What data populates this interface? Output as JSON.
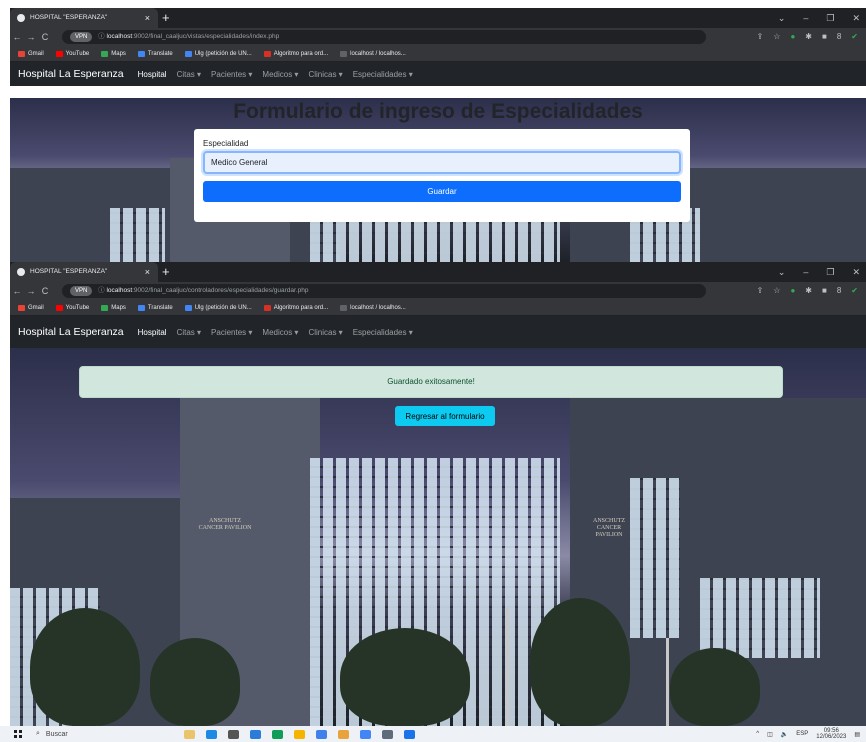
{
  "shot1": {
    "tab_title": "HOSPITAL \"ESPERANZA\"",
    "url_host": "localhost",
    "url_path": ":9002/final_caaljuc/vistas/especialidades/index.php",
    "page_title": "Formulario de ingreso de Especialidades",
    "form": {
      "label": "Especialidad",
      "value": "Medico General",
      "submit_label": "Guardar"
    }
  },
  "shot2": {
    "tab_title": "HOSPITAL \"ESPERANZA\"",
    "url_host": "localhost",
    "url_path": ":9002/final_caaljuc/controladores/especialidades/guardar.php",
    "alert_text": "Guardado exitosamente!",
    "back_button_label": "Regresar al formulario"
  },
  "browser": {
    "vpn_label": "VPN",
    "tab_close": "×",
    "new_tab": "+",
    "bookmarks": [
      "Gmail",
      "YouTube",
      "Maps",
      "Translate",
      "Ulg (petición de UN...",
      "Algoritmo para ord...",
      "localhost / localhos..."
    ],
    "bookmark_colors": [
      "#ea4335",
      "#ff0000",
      "#34a853",
      "#4285f4",
      "#4285f4",
      "#d93025",
      "#5f6368"
    ]
  },
  "app_nav": {
    "brand": "Hospital La Esperanza",
    "home": "Hospital",
    "menus": [
      "Citas ▾",
      "Pacientes ▾",
      "Medicos ▾",
      "Clinicas ▾",
      "Especialidades ▾"
    ]
  },
  "building_signs": {
    "left": "ANSCHUTZ\nCANCER PAVILION",
    "right": "ANSCHUTZ\nCANCER\nPAVILION"
  },
  "taskbar": {
    "search_placeholder": "Buscar",
    "language": "ESP",
    "time": "09:56",
    "date": "12/06/2023"
  },
  "colors": {
    "navbar_bg": "#212529",
    "primary": "#0d6efd",
    "info": "#0dcaf0",
    "success_bg": "#d1e7dd",
    "success_text": "#0f5132"
  }
}
